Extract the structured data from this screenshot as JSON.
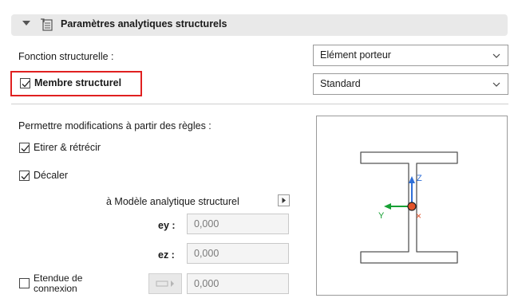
{
  "header": {
    "title": "Paramètres analytiques structurels",
    "collapse_icon": "triangle-down-icon",
    "section_icon": "structural-settings-icon"
  },
  "structural_function": {
    "label": "Fonction structurelle :",
    "value": "Elément porteur"
  },
  "structural_member": {
    "label": "Membre structurel",
    "checked": true,
    "value": "Standard",
    "highlight_color": "#e02020"
  },
  "rules": {
    "label": "Permettre modifications à partir des règles :",
    "stretch": {
      "label": "Etirer & rétrécir",
      "checked": true
    },
    "offset": {
      "label": "Décaler",
      "checked": true
    }
  },
  "analytical_model": {
    "label": "à Modèle analytique structurel",
    "arrow_icon": "play-right-icon"
  },
  "ey": {
    "label": "ey :",
    "value": "0,000"
  },
  "ez": {
    "label": "ez :",
    "value": "0,000"
  },
  "connection": {
    "label_line1": "Etendue de",
    "label_line2": "connexion",
    "checked": false,
    "value": "0,000"
  },
  "preview": {
    "axis_z": "Z",
    "axis_y": "Y",
    "axis_x": "×",
    "colors": {
      "z": "#2f6fd8",
      "y": "#17a034",
      "origin": "#e2532a"
    }
  }
}
